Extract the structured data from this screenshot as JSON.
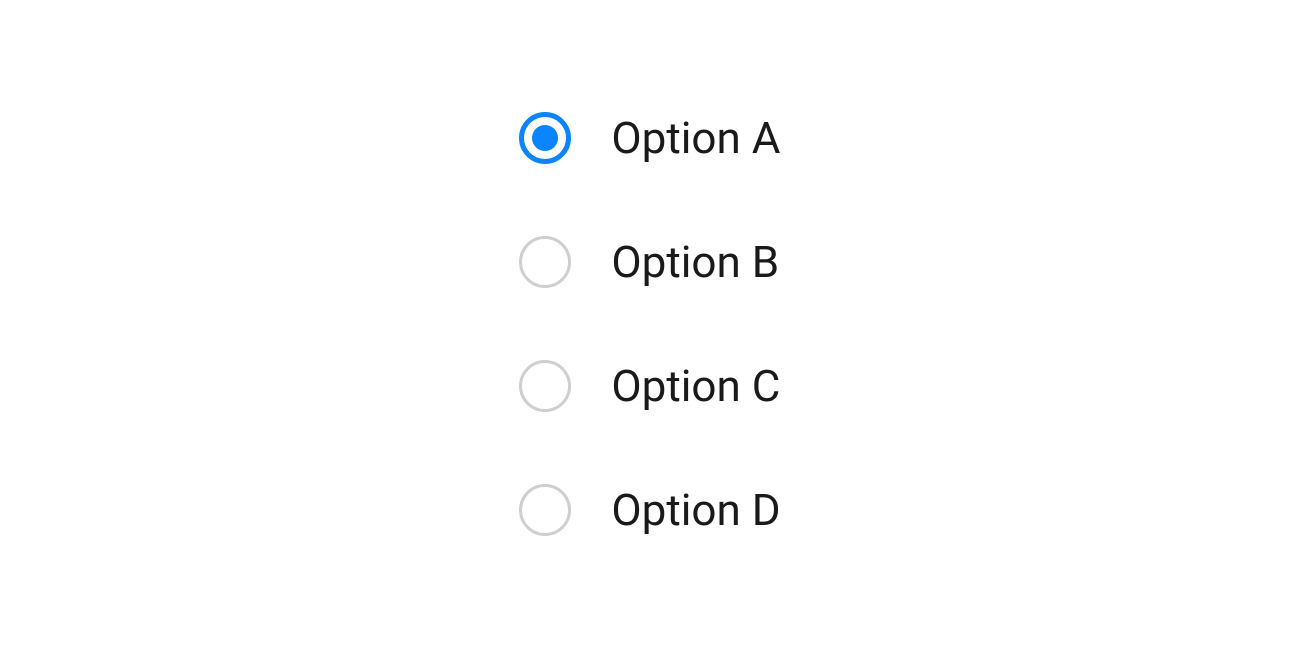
{
  "options": [
    {
      "label": "Option A",
      "selected": true
    },
    {
      "label": "Option B",
      "selected": false
    },
    {
      "label": "Option C",
      "selected": false
    },
    {
      "label": "Option D",
      "selected": false
    }
  ],
  "colors": {
    "accent": "#0a84ff",
    "unselected_border": "#cfcfcf",
    "text": "#1a1a1a"
  }
}
